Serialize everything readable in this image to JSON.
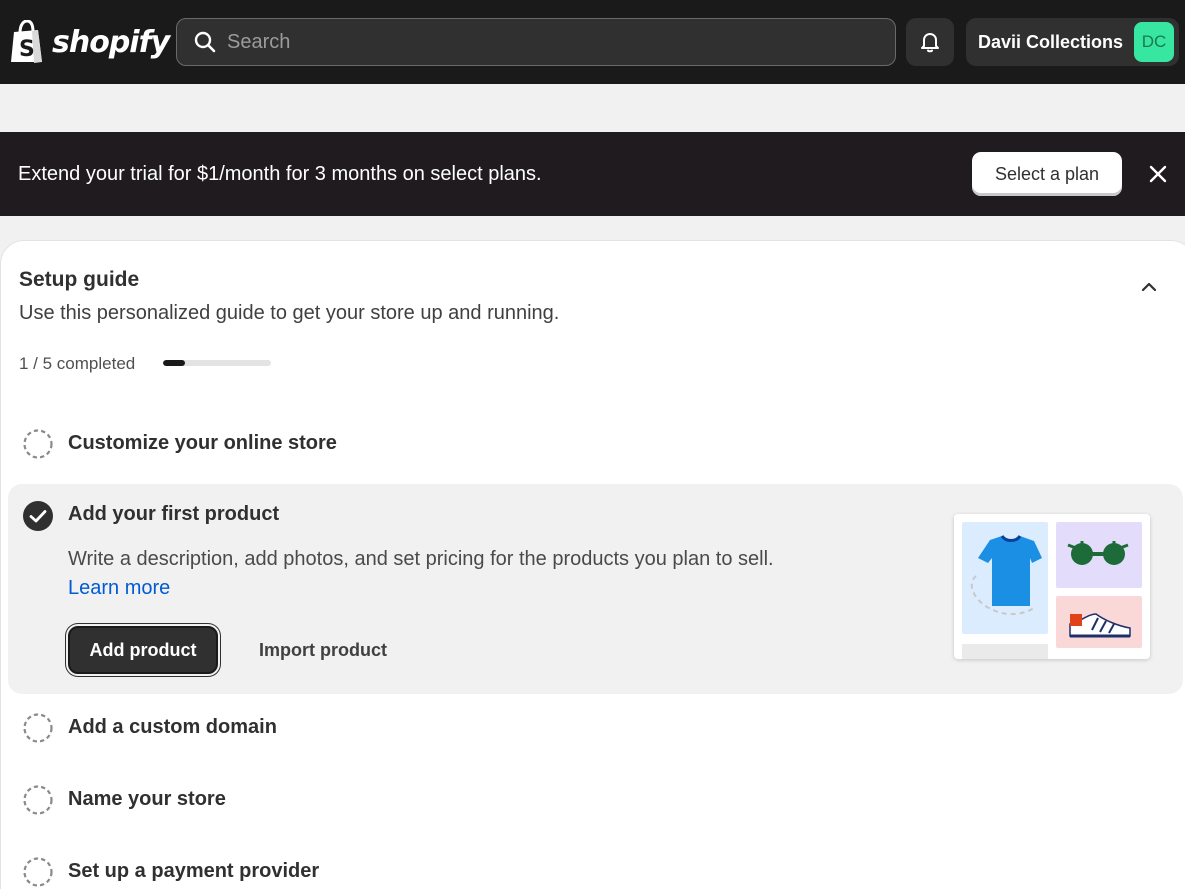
{
  "topbar": {
    "logo_text": "shopify",
    "search_placeholder": "Search",
    "store_name": "Davii Collections",
    "avatar_initials": "DC"
  },
  "banner": {
    "message": "Extend your trial for $1/month for 3 months on select plans.",
    "button_label": "Select a plan"
  },
  "setup_guide": {
    "title": "Setup guide",
    "subtitle": "Use this personalized guide to get your store up and running.",
    "progress_text": "1 / 5 completed",
    "progress_fraction": 0.2,
    "tasks": [
      {
        "label": "Customize your online store",
        "completed": false
      },
      {
        "label": "Add your first product",
        "completed": true,
        "description": "Write a description, add photos, and set pricing for the products you plan to sell.",
        "learn_more": "Learn more",
        "primary_action": "Add product",
        "secondary_action": "Import product"
      },
      {
        "label": "Add a custom domain",
        "completed": false
      },
      {
        "label": "Name your store",
        "completed": false
      },
      {
        "label": "Set up a payment provider",
        "completed": false
      }
    ]
  },
  "colors": {
    "topbar_bg": "#1a1a1a",
    "banner_bg": "#1f1b1f",
    "avatar_bg": "#36e6a1",
    "link": "#005bd3"
  }
}
